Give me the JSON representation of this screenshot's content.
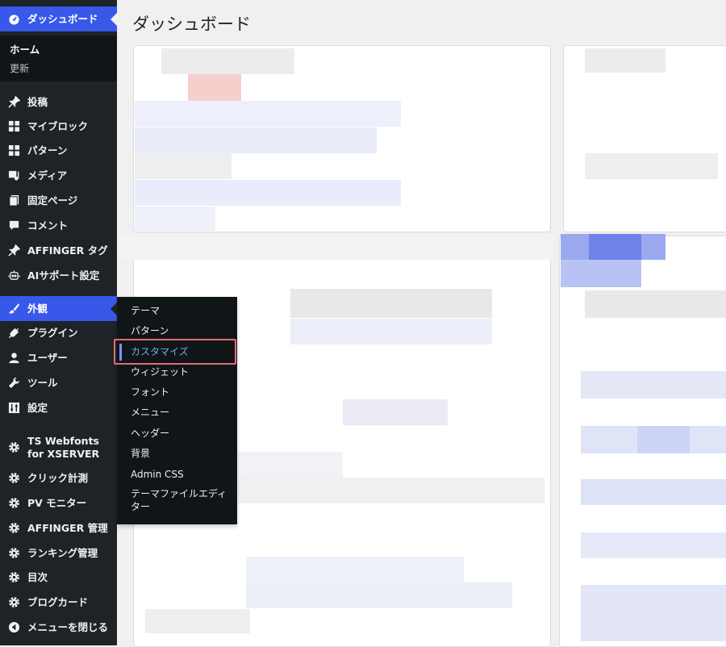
{
  "app": {
    "page_title": "ダッシュボード"
  },
  "sidebar": {
    "dashboard": "ダッシュボード",
    "dashboard_sub": {
      "home": "ホーム",
      "update": "更新"
    },
    "items": [
      {
        "label": "投稿",
        "icon": "pin-icon"
      },
      {
        "label": "マイブロック",
        "icon": "blocks-icon"
      },
      {
        "label": "パターン",
        "icon": "blocks-icon"
      },
      {
        "label": "メディア",
        "icon": "media-icon"
      },
      {
        "label": "固定ページ",
        "icon": "page-icon"
      },
      {
        "label": "コメント",
        "icon": "comment-icon"
      },
      {
        "label": "AFFINGER タグ",
        "icon": "pin-icon"
      },
      {
        "label": "AIサポート設定",
        "icon": "robot-icon"
      },
      {
        "label": "外観",
        "icon": "brush-icon"
      },
      {
        "label": "プラグイン",
        "icon": "plug-icon"
      },
      {
        "label": "ユーザー",
        "icon": "user-icon"
      },
      {
        "label": "ツール",
        "icon": "wrench-icon"
      },
      {
        "label": "設定",
        "icon": "settings-icon"
      },
      {
        "label": "TS Webfonts for XSERVER",
        "icon": "gear-icon"
      },
      {
        "label": "クリック計測",
        "icon": "gear-icon"
      },
      {
        "label": "PV モニター",
        "icon": "gear-icon"
      },
      {
        "label": "AFFINGER 管理",
        "icon": "gear-icon"
      },
      {
        "label": "ランキング管理",
        "icon": "gear-icon"
      },
      {
        "label": "目次",
        "icon": "gear-icon"
      },
      {
        "label": "ブログカード",
        "icon": "gear-icon"
      },
      {
        "label": "メニューを閉じる",
        "icon": "collapse-icon"
      }
    ]
  },
  "flyout": {
    "items": [
      "テーマ",
      "パターン",
      "カスタマイズ",
      "ウィジェット",
      "フォント",
      "メニュー",
      "ヘッダー",
      "背景",
      "Admin CSS",
      "テーマファイルエディター"
    ],
    "selected": "カスタマイズ"
  },
  "colors": {
    "sidebar_bg": "#1d2327",
    "accent": "#3858e9",
    "highlight_border": "#e26d74"
  }
}
